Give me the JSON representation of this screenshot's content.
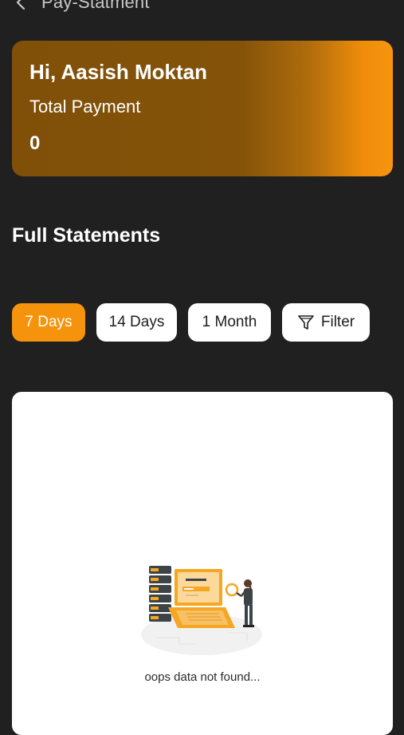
{
  "header": {
    "title": "Pay-Statment",
    "back_icon": "chevron-left-icon"
  },
  "summary": {
    "greeting": "Hi, Aasish Moktan",
    "total_label": "Total Payment",
    "total_value": "0",
    "gradient_colors": [
      "#805009",
      "#f7950e"
    ]
  },
  "statements": {
    "title": "Full Statements",
    "filters": [
      {
        "label": "7 Days",
        "active": true
      },
      {
        "label": "14 Days",
        "active": false
      },
      {
        "label": "1 Month",
        "active": false
      }
    ],
    "filter_button": {
      "label": "Filter",
      "icon": "funnel-icon"
    }
  },
  "empty_state": {
    "message": "oops data not found...",
    "illustration_icon": "data-not-found-illustration"
  },
  "colors": {
    "background": "#202020",
    "accent": "#f5940c",
    "chip_bg": "#ffffff"
  }
}
